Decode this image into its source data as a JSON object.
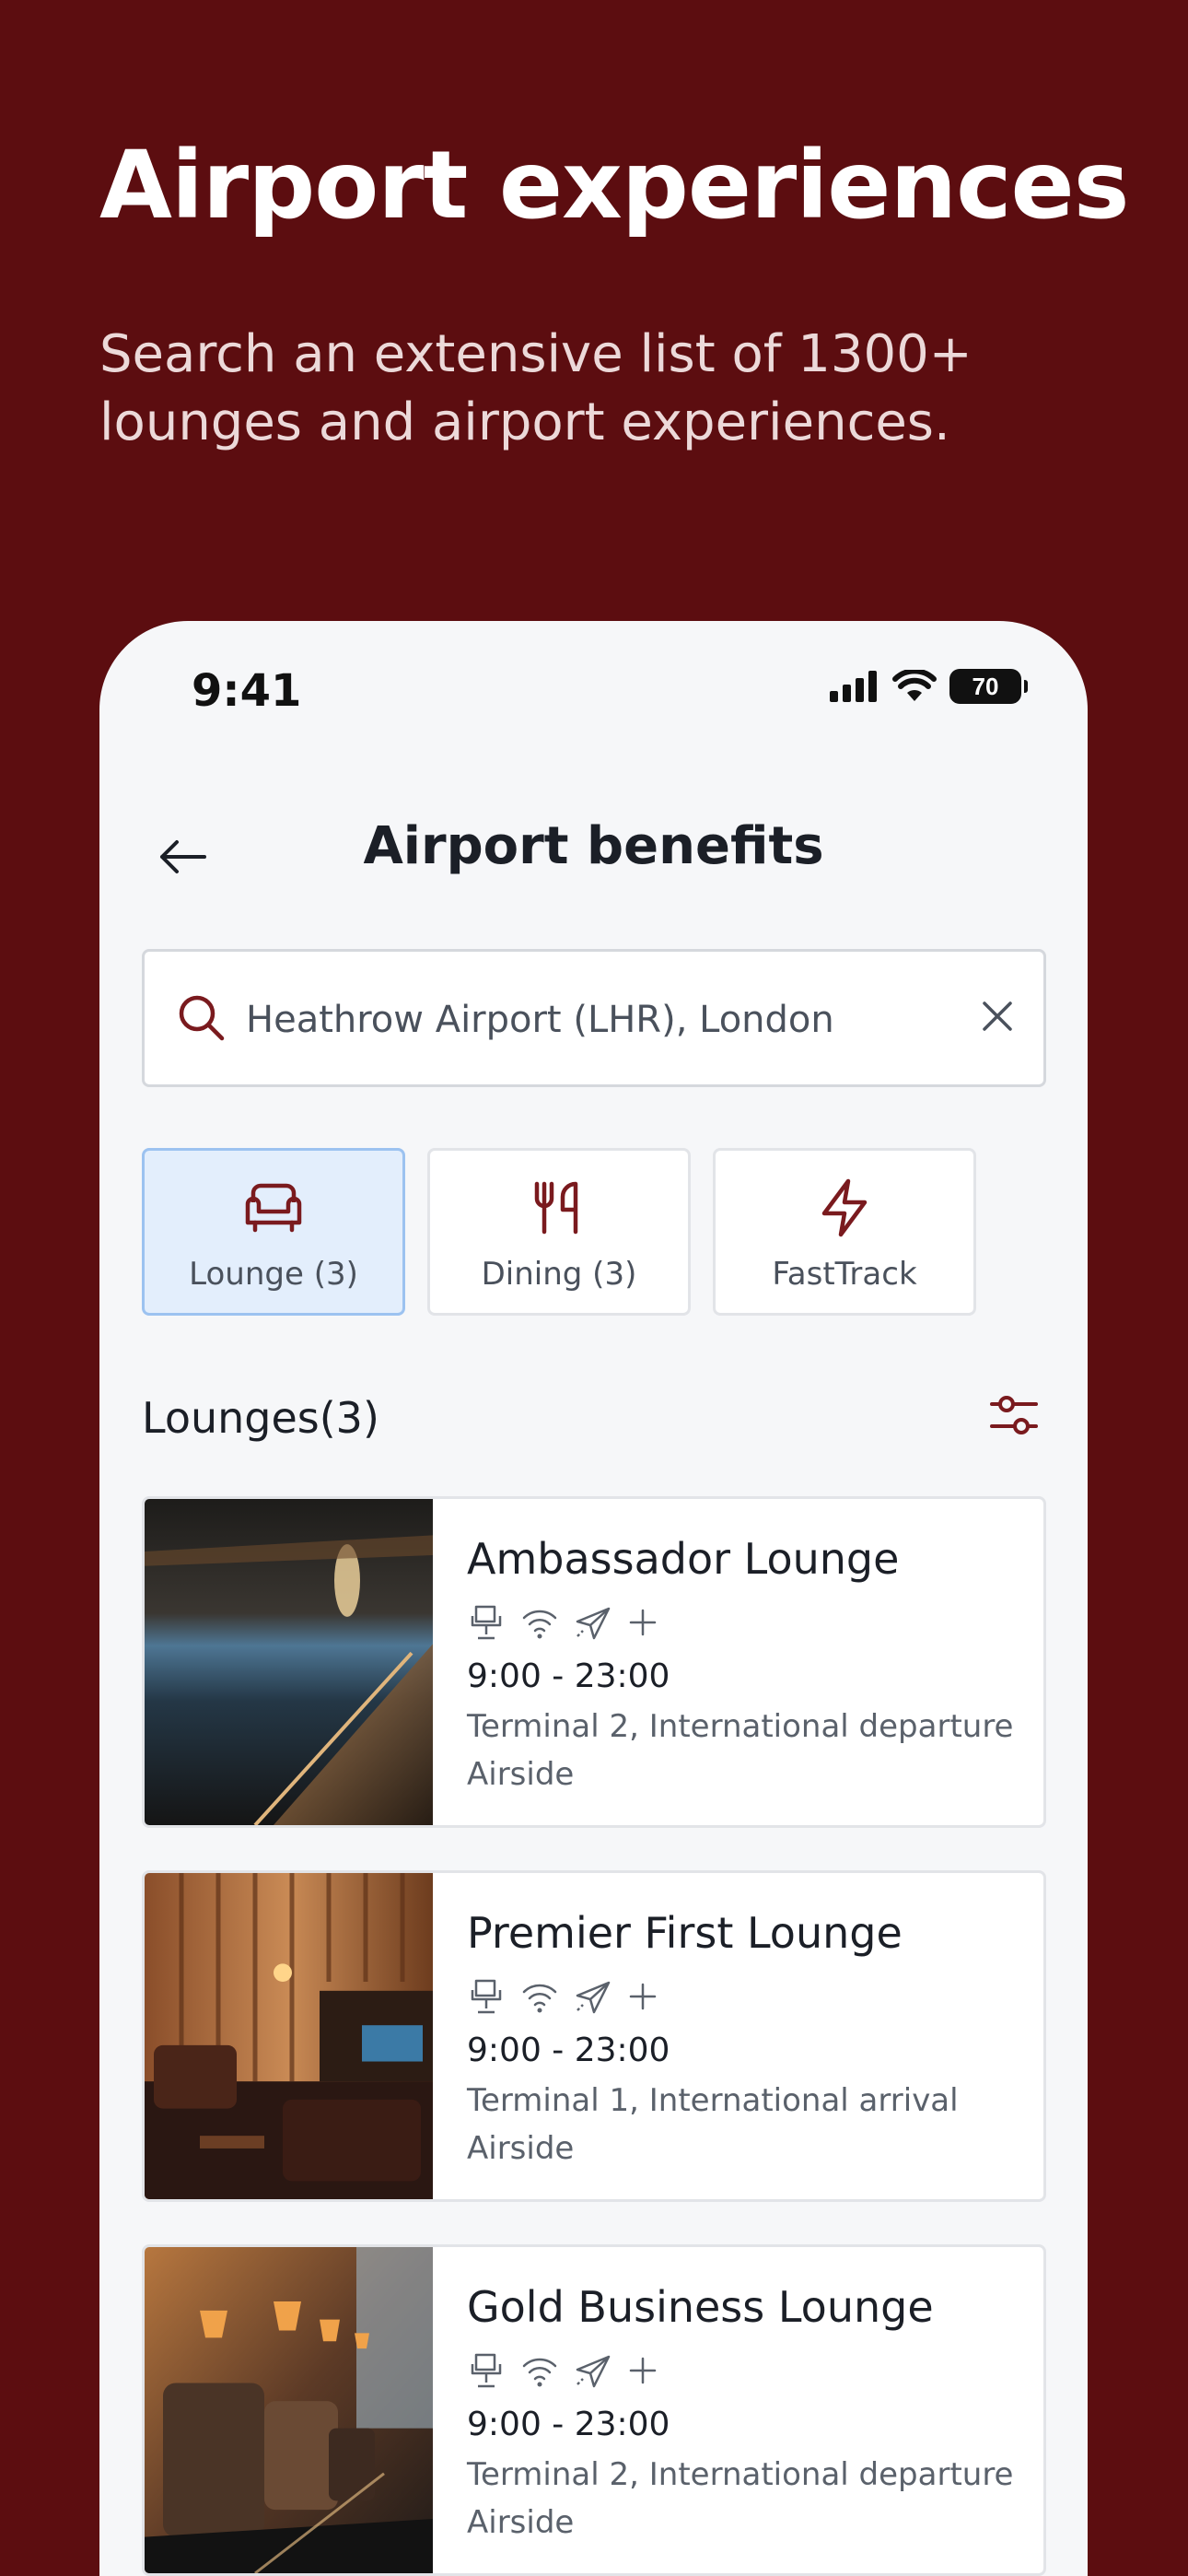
{
  "hero": {
    "title": "Airport experiences",
    "subtitle": "Search an extensive list of 1300+ lounges and airport experiences."
  },
  "status_bar": {
    "time": "9:41",
    "battery": "70"
  },
  "nav": {
    "title": "Airport benefits"
  },
  "search": {
    "value": "Heathrow Airport (LHR), London"
  },
  "categories": [
    {
      "label": "Lounge (3)",
      "icon": "armchair-icon",
      "active": true
    },
    {
      "label": "Dining (3)",
      "icon": "fork-knife-icon",
      "active": false
    },
    {
      "label": "FastTrack",
      "icon": "lightning-icon",
      "active": false
    }
  ],
  "section": {
    "title": "Lounges(3)"
  },
  "lounges": [
    {
      "name": "Ambassador Lounge",
      "hours": "9:00 - 23:00",
      "location": "Terminal 2, International departure",
      "side": "Airside"
    },
    {
      "name": "Premier First Lounge",
      "hours": "9:00 - 23:00",
      "location": "Terminal 1, International arrival",
      "side": "Airside"
    },
    {
      "name": "Gold Business Lounge",
      "hours": "9:00 - 23:00",
      "location": "Terminal 2, International departure",
      "side": "Airside"
    }
  ],
  "amenity_icons": [
    "seat-icon",
    "wifi-icon",
    "plane-icon",
    "plus-icon"
  ],
  "colors": {
    "brand": "#5c0d10",
    "accent": "#7a1a1e",
    "active_chip_bg": "#e3eefc",
    "active_chip_border": "#9cc2f0"
  }
}
